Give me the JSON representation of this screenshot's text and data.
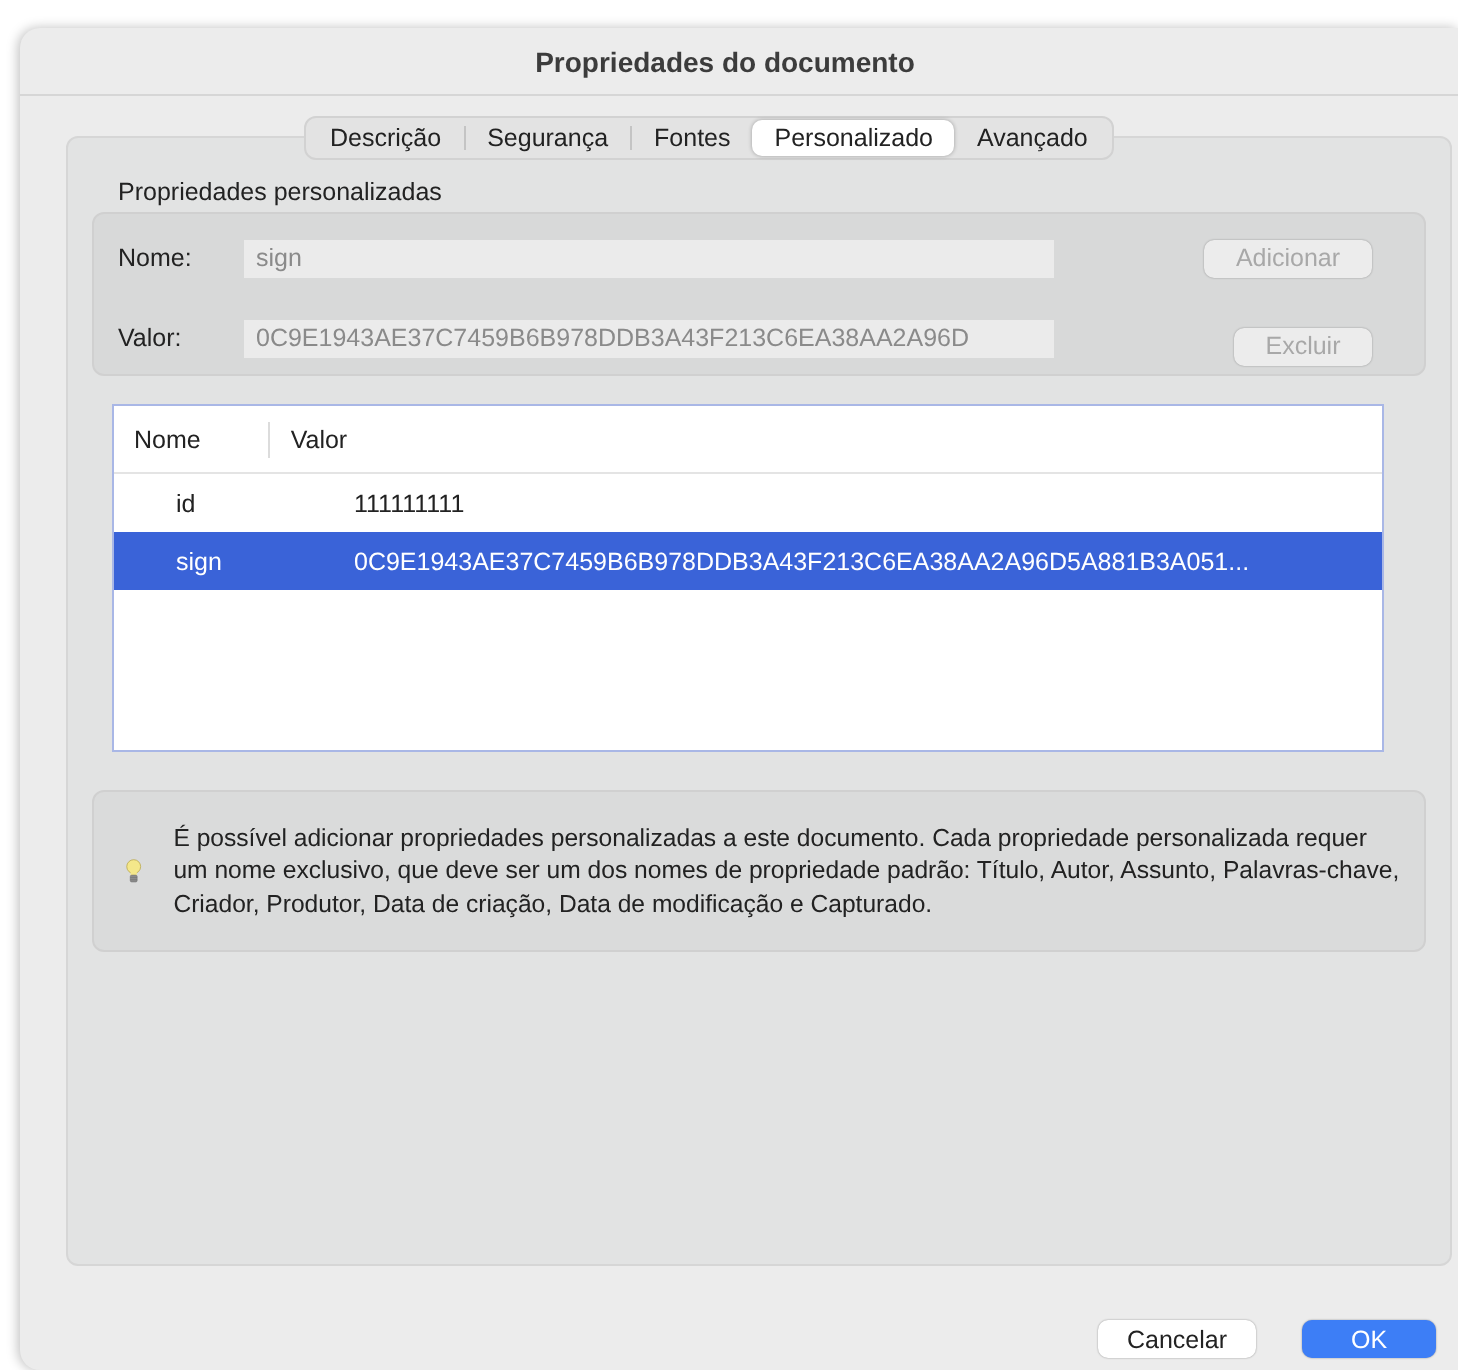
{
  "window": {
    "title": "Propriedades do documento"
  },
  "tabs": [
    {
      "label": "Descrição",
      "selected": false
    },
    {
      "label": "Segurança",
      "selected": false
    },
    {
      "label": "Fontes",
      "selected": false
    },
    {
      "label": "Personalizado",
      "selected": true
    },
    {
      "label": "Avançado",
      "selected": false
    }
  ],
  "custom_properties": {
    "label": "Propriedades personalizadas",
    "name_field": {
      "label": "Nome:",
      "value": "sign",
      "disabled": true
    },
    "value_field": {
      "label": "Valor:",
      "value": "0C9E1943AE37C7459B6B978DDB3A43F213C6EA38AA2A96D",
      "disabled": true
    },
    "add_button": {
      "label": "Adicionar",
      "disabled": true
    },
    "delete_button": {
      "label": "Excluir",
      "disabled": true
    }
  },
  "table": {
    "columns": [
      "Nome",
      "Valor"
    ],
    "rows": [
      {
        "name": "id",
        "value": "111111111",
        "selected": false
      },
      {
        "name": "sign",
        "value": "0C9E1943AE37C7459B6B978DDB3A43F213C6EA38AA2A96D5A881B3A051...",
        "selected": true
      }
    ]
  },
  "info": {
    "text": "É possível adicionar propriedades personalizadas a este documento. Cada propriedade personalizada requer um nome exclusivo, que deve ser um dos nomes de propriedade padrão: Título, Autor, Assunto, Palavras-chave, Criador, Produtor, Data de criação, Data de modificação e Capturado."
  },
  "buttons": [
    {
      "label": "Cancelar",
      "kind": "secondary"
    },
    {
      "label": "OK",
      "kind": "primary"
    }
  ]
}
